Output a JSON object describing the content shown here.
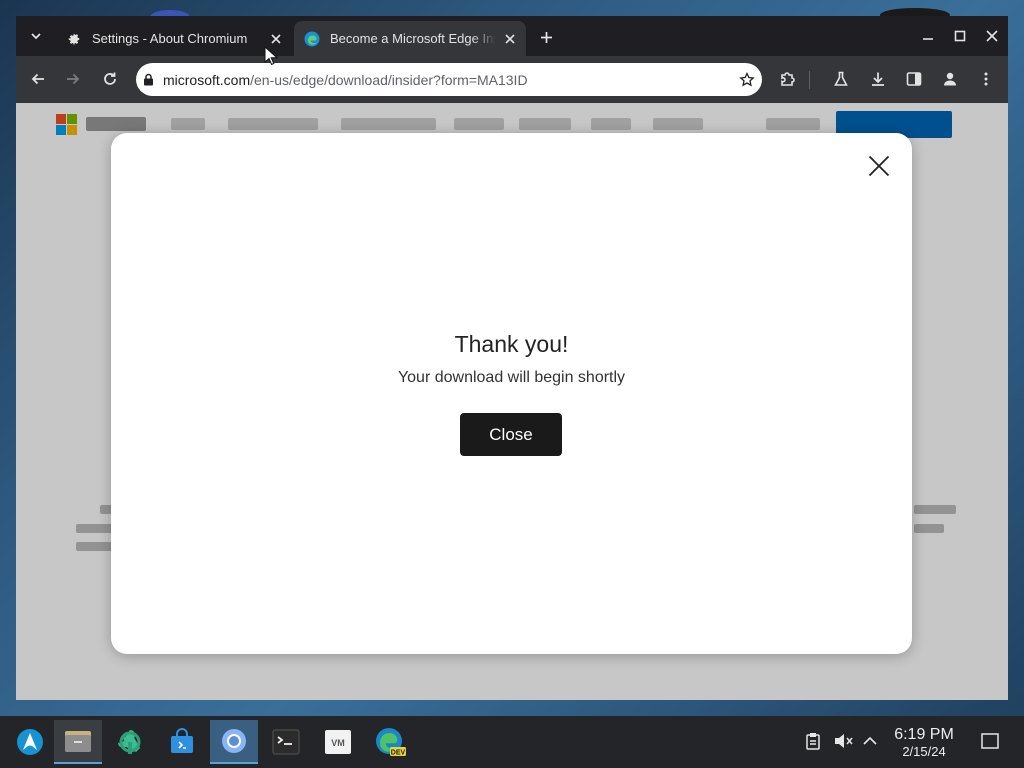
{
  "browser": {
    "tabs": [
      {
        "title": "Settings - About Chromium",
        "icon": "gear-icon",
        "active": false
      },
      {
        "title": "Become a Microsoft Edge Insider",
        "icon": "edge-icon",
        "active": true
      }
    ],
    "address": {
      "host": "microsoft.com",
      "path": "/en-us/edge/download/insider?form=MA13ID"
    }
  },
  "modal": {
    "title": "Thank you!",
    "subtitle": "Your download will begin shortly",
    "close_label": "Close"
  },
  "taskbar": {
    "time": "6:19 PM",
    "date": "2/15/24",
    "apps": [
      "app-launcher",
      "files",
      "system-settings",
      "app-store",
      "chromium",
      "terminal",
      "vmware",
      "edge-dev"
    ]
  },
  "colors": {
    "tab_bar": "#1f1f23",
    "toolbar": "#35363a",
    "modal_button": "#1a1a1a",
    "taskbar": "#232528",
    "accent": "#5aa2d6"
  }
}
